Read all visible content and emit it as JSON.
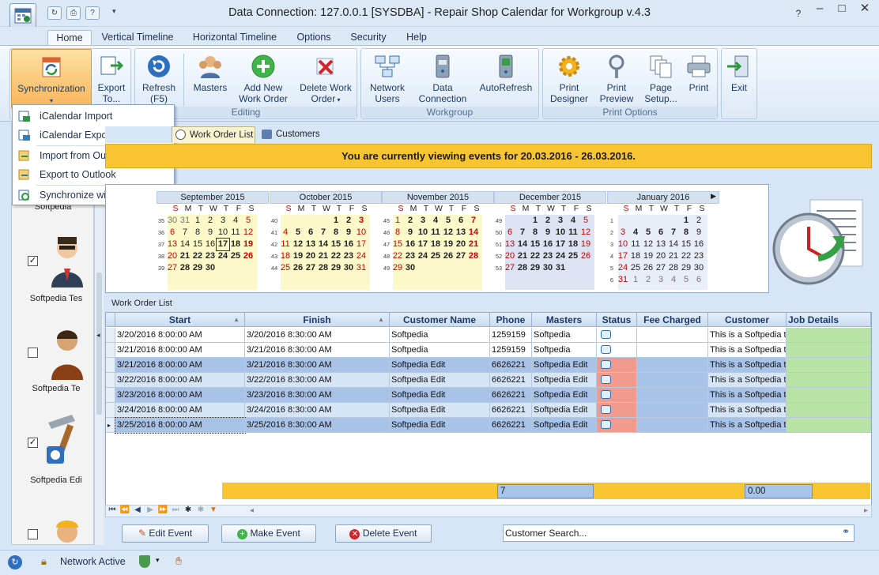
{
  "window": {
    "title": "Data Connection: 127.0.0.1 [SYSDBA] - Repair Shop Calendar for Workgroup v.4.3"
  },
  "menu_tabs": [
    "Home",
    "Vertical Timeline",
    "Horizontal Timeline",
    "Options",
    "Security",
    "Help"
  ],
  "ribbon": {
    "sync": "Synchronization",
    "export1": "Export",
    "export2": "To...",
    "refresh1": "Refresh",
    "refresh2": "(F5)",
    "masters": "Masters",
    "addwo1": "Add New",
    "addwo2": "Work Order",
    "delwo1": "Delete Work",
    "delwo2": "Order",
    "netusers1": "Network",
    "netusers2": "Users",
    "dataconn1": "Data",
    "dataconn2": "Connection",
    "autorefresh": "AutoRefresh",
    "pdesigner1": "Print",
    "pdesigner2": "Designer",
    "ppreview1": "Print",
    "ppreview2": "Preview",
    "psetup1": "Page",
    "psetup2": "Setup...",
    "print": "Print",
    "exit": "Exit",
    "group_editing": "Editing",
    "group_workgroup": "Workgroup",
    "group_print": "Print Options"
  },
  "sync_menu": [
    "iCalendar Import",
    "iCalendar Export",
    "Import from Outlook",
    "Export to Outlook",
    "Synchronize with Outlook"
  ],
  "left_panel": {
    "labels": [
      "Softpedia",
      "Softpedia Tes",
      "Softpedia Te",
      "Softpedia Edi"
    ]
  },
  "subtabs": {
    "work_order_list": "Work Order List",
    "customers": "Customers"
  },
  "banner": "You are currently viewing events for 20.03.2016 - 26.03.2016.",
  "calendar": {
    "dow": [
      "S",
      "M",
      "T",
      "W",
      "T",
      "F",
      "S"
    ],
    "months": [
      {
        "name": "September 2015",
        "weeks": [
          {
            "wk": "35",
            "days": [
              "30",
              "31",
              "1",
              "2",
              "3",
              "4",
              "5"
            ]
          },
          {
            "wk": "36",
            "days": [
              "6",
              "7",
              "8",
              "9",
              "10",
              "11",
              "12"
            ]
          },
          {
            "wk": "37",
            "days": [
              "13",
              "14",
              "15",
              "16",
              "17",
              "18",
              "19"
            ]
          },
          {
            "wk": "38",
            "days": [
              "20",
              "21",
              "22",
              "23",
              "24",
              "25",
              "26"
            ]
          },
          {
            "wk": "39",
            "days": [
              "27",
              "28",
              "29",
              "30",
              "",
              "",
              ""
            ]
          }
        ]
      },
      {
        "name": "October 2015",
        "weeks": [
          {
            "wk": "40",
            "days": [
              "",
              "",
              "",
              "",
              "1",
              "2",
              "3"
            ]
          },
          {
            "wk": "41",
            "days": [
              "4",
              "5",
              "6",
              "7",
              "8",
              "9",
              "10"
            ]
          },
          {
            "wk": "42",
            "days": [
              "11",
              "12",
              "13",
              "14",
              "15",
              "16",
              "17"
            ]
          },
          {
            "wk": "43",
            "days": [
              "18",
              "19",
              "20",
              "21",
              "22",
              "23",
              "24"
            ]
          },
          {
            "wk": "44",
            "days": [
              "25",
              "26",
              "27",
              "28",
              "29",
              "30",
              "31"
            ]
          }
        ]
      },
      {
        "name": "November 2015",
        "weeks": [
          {
            "wk": "45",
            "days": [
              "1",
              "2",
              "3",
              "4",
              "5",
              "6",
              "7"
            ]
          },
          {
            "wk": "46",
            "days": [
              "8",
              "9",
              "10",
              "11",
              "12",
              "13",
              "14"
            ]
          },
          {
            "wk": "47",
            "days": [
              "15",
              "16",
              "17",
              "18",
              "19",
              "20",
              "21"
            ]
          },
          {
            "wk": "48",
            "days": [
              "22",
              "23",
              "24",
              "25",
              "26",
              "27",
              "28"
            ]
          },
          {
            "wk": "49",
            "days": [
              "29",
              "30",
              "",
              "",
              "",
              "",
              ""
            ]
          }
        ]
      },
      {
        "name": "December 2015",
        "weeks": [
          {
            "wk": "49",
            "days": [
              "",
              "",
              "1",
              "2",
              "3",
              "4",
              "5"
            ]
          },
          {
            "wk": "50",
            "days": [
              "6",
              "7",
              "8",
              "9",
              "10",
              "11",
              "12"
            ]
          },
          {
            "wk": "51",
            "days": [
              "13",
              "14",
              "15",
              "16",
              "17",
              "18",
              "19"
            ]
          },
          {
            "wk": "52",
            "days": [
              "20",
              "21",
              "22",
              "23",
              "24",
              "25",
              "26"
            ]
          },
          {
            "wk": "53",
            "days": [
              "27",
              "28",
              "29",
              "30",
              "31",
              "",
              ""
            ]
          }
        ]
      },
      {
        "name": "January 2016",
        "weeks": [
          {
            "wk": "1",
            "days": [
              "",
              "",
              "",
              "",
              "",
              "1",
              "2"
            ]
          },
          {
            "wk": "2",
            "days": [
              "3",
              "4",
              "5",
              "6",
              "7",
              "8",
              "9"
            ]
          },
          {
            "wk": "3",
            "days": [
              "10",
              "11",
              "12",
              "13",
              "14",
              "15",
              "16"
            ]
          },
          {
            "wk": "4",
            "days": [
              "17",
              "18",
              "19",
              "20",
              "21",
              "22",
              "23"
            ]
          },
          {
            "wk": "5",
            "days": [
              "24",
              "25",
              "26",
              "27",
              "28",
              "29",
              "30"
            ]
          },
          {
            "wk": "6",
            "days": [
              "31",
              "1",
              "2",
              "3",
              "4",
              "5",
              "6"
            ]
          }
        ]
      }
    ]
  },
  "work_order_list_label": "Work Order List",
  "grid": {
    "columns": [
      "Start",
      "Finish",
      "Customer Name",
      "Phone",
      "Masters",
      "Status",
      "Fee Charged",
      "Customer Details",
      "Job Details"
    ],
    "rows": [
      [
        "3/20/2016 8:00:00 AM",
        "3/20/2016 8:30:00 AM",
        "Softpedia",
        "1259159",
        "Softpedia",
        "",
        "",
        "This is a Softpedia te",
        ""
      ],
      [
        "3/21/2016 8:00:00 AM",
        "3/21/2016 8:30:00 AM",
        "Softpedia",
        "1259159",
        "Softpedia",
        "",
        "",
        "This is a Softpedia te",
        ""
      ],
      [
        "3/21/2016 8:00:00 AM",
        "3/21/2016 8:30:00 AM",
        "Softpedia Edit",
        "6626221",
        "Softpedia Edit",
        "",
        "",
        "This is a Softpedia te",
        ""
      ],
      [
        "3/22/2016 8:00:00 AM",
        "3/22/2016 8:30:00 AM",
        "Softpedia Edit",
        "6626221",
        "Softpedia Edit",
        "",
        "",
        "This is a Softpedia te",
        ""
      ],
      [
        "3/23/2016 8:00:00 AM",
        "3/23/2016 8:30:00 AM",
        "Softpedia Edit",
        "6626221",
        "Softpedia Edit",
        "",
        "",
        "This is a Softpedia te",
        ""
      ],
      [
        "3/24/2016 8:00:00 AM",
        "3/24/2016 8:30:00 AM",
        "Softpedia Edit",
        "6626221",
        "Softpedia Edit",
        "",
        "",
        "This is a Softpedia te",
        ""
      ],
      [
        "3/25/2016 8:00:00 AM",
        "3/25/2016 8:30:00 AM",
        "Softpedia Edit",
        "6626221",
        "Softpedia Edit",
        "",
        "",
        "This is a Softpedia te",
        ""
      ]
    ],
    "summary_count": "7",
    "summary_fee": "0.00"
  },
  "actions": {
    "edit": "Edit Event",
    "make": "Make Event",
    "delete": "Delete Event",
    "search_value": "Customer Search..."
  },
  "status": {
    "network": "Network Active"
  },
  "colors": {
    "accent": "#f8c530",
    "row_selected": "#a9c3e8",
    "status_red": "#f19a8d",
    "job_green": "#b9e3a4"
  }
}
